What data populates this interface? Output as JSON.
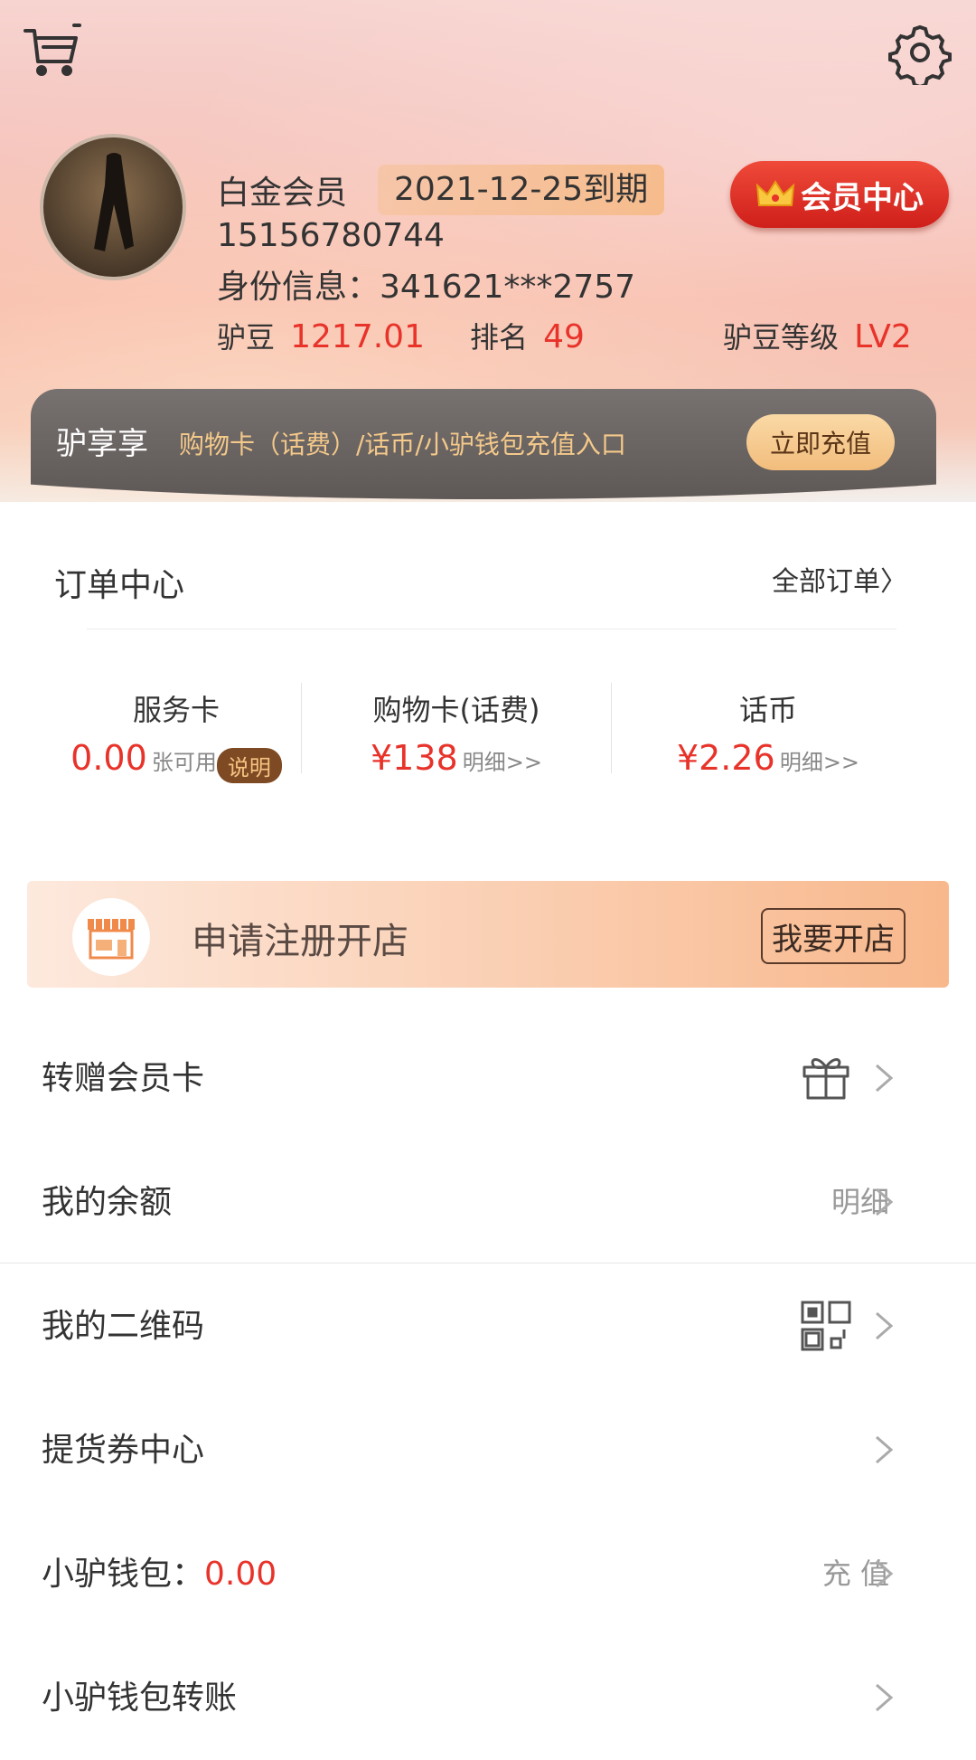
{
  "header": {
    "member_level": "白金会员",
    "expiry": "2021-12-25到期",
    "vip_button": "会员中心",
    "phone": "15156780744",
    "id_info": "身份信息：341621***2757",
    "beans_label": "驴豆",
    "beans_value": "1217.01",
    "rank_label": "排名",
    "rank_value": "49",
    "level_label": "驴豆等级",
    "level_value": "LV2"
  },
  "recharge": {
    "title": "驴享享",
    "desc": "购物卡（话费）/话币/小驴钱包充值入口",
    "button": "立即充值"
  },
  "orders": {
    "title": "订单中心",
    "all_link": "全部订单〉",
    "cards": [
      {
        "title": "服务卡",
        "value": "0.00",
        "unit": "张可用",
        "badge": "说明"
      },
      {
        "title": "购物卡(话费)",
        "value": "¥138",
        "detail": "明细>>"
      },
      {
        "title": "话币",
        "value": "¥2.26",
        "detail": "明细>>"
      }
    ]
  },
  "shop": {
    "text": "申请注册开店",
    "button": "我要开店"
  },
  "menu": [
    {
      "label": "转赠会员卡",
      "right_icon": "gift-icon"
    },
    {
      "label": "我的余额",
      "right_text": "明细"
    },
    {
      "label": "我的二维码",
      "right_icon": "qr-code-icon"
    },
    {
      "label": "提货券中心"
    },
    {
      "label": "小驴钱包：",
      "value": "0.00",
      "right_text": "充 值"
    },
    {
      "label": "小驴钱包转账"
    }
  ],
  "colors": {
    "accent_red": "#e8332a",
    "gold": "#f4c98a"
  }
}
